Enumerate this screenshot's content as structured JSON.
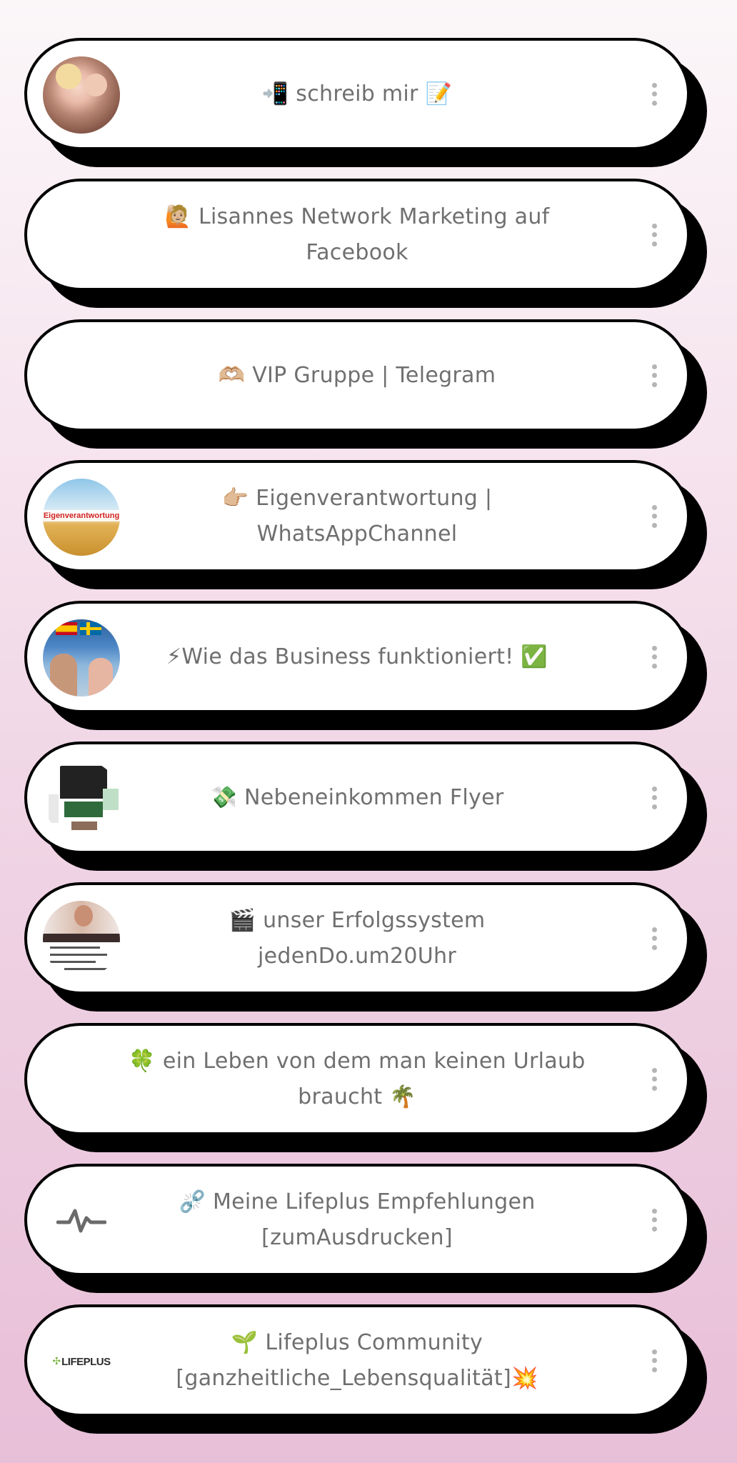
{
  "links": [
    {
      "label": "📲 schreib mir 📝",
      "thumb": "family-photo"
    },
    {
      "label": "🙋🏼 Lisannes Network Marketing auf Facebook",
      "thumb": null
    },
    {
      "label": "🫶🏼 VIP Gruppe | Telegram",
      "thumb": null
    },
    {
      "label": "👉🏼 Eigenverantwortung | WhatsAppChannel",
      "thumb": "eigenverantwortung-image",
      "thumb_text": "Eigenverantwortung"
    },
    {
      "label": "⚡Wie das Business funktioniert! ✅",
      "thumb": "business-video-thumb"
    },
    {
      "label": "💸 Nebeneinkommen Flyer",
      "thumb": "flyer-thumb"
    },
    {
      "label": "🎬 unser Erfolgssystem jedenDo.um20Uhr",
      "thumb": "erfolgssystem-thumb"
    },
    {
      "label": "🍀 ein Leben von dem man keinen Urlaub braucht 🌴",
      "thumb": null
    },
    {
      "label": "⛓️‍💥 Meine Lifeplus Empfehlungen [zumAusdrucken]",
      "thumb": "pulse-icon"
    },
    {
      "label": "🌱 Lifeplus Community [ganzheitliche_Lebensqualität]💥",
      "thumb": "lifeplus-logo",
      "thumb_text": "LIFEPLUS"
    }
  ],
  "colors": {
    "card_bg": "#ffffff",
    "card_border": "#000000",
    "shadow": "#000000",
    "label": "#6f6f6f",
    "menu_dots": "#b5b5b5",
    "page_top": "#fbf7f9",
    "page_bottom": "#e8bfd8"
  }
}
